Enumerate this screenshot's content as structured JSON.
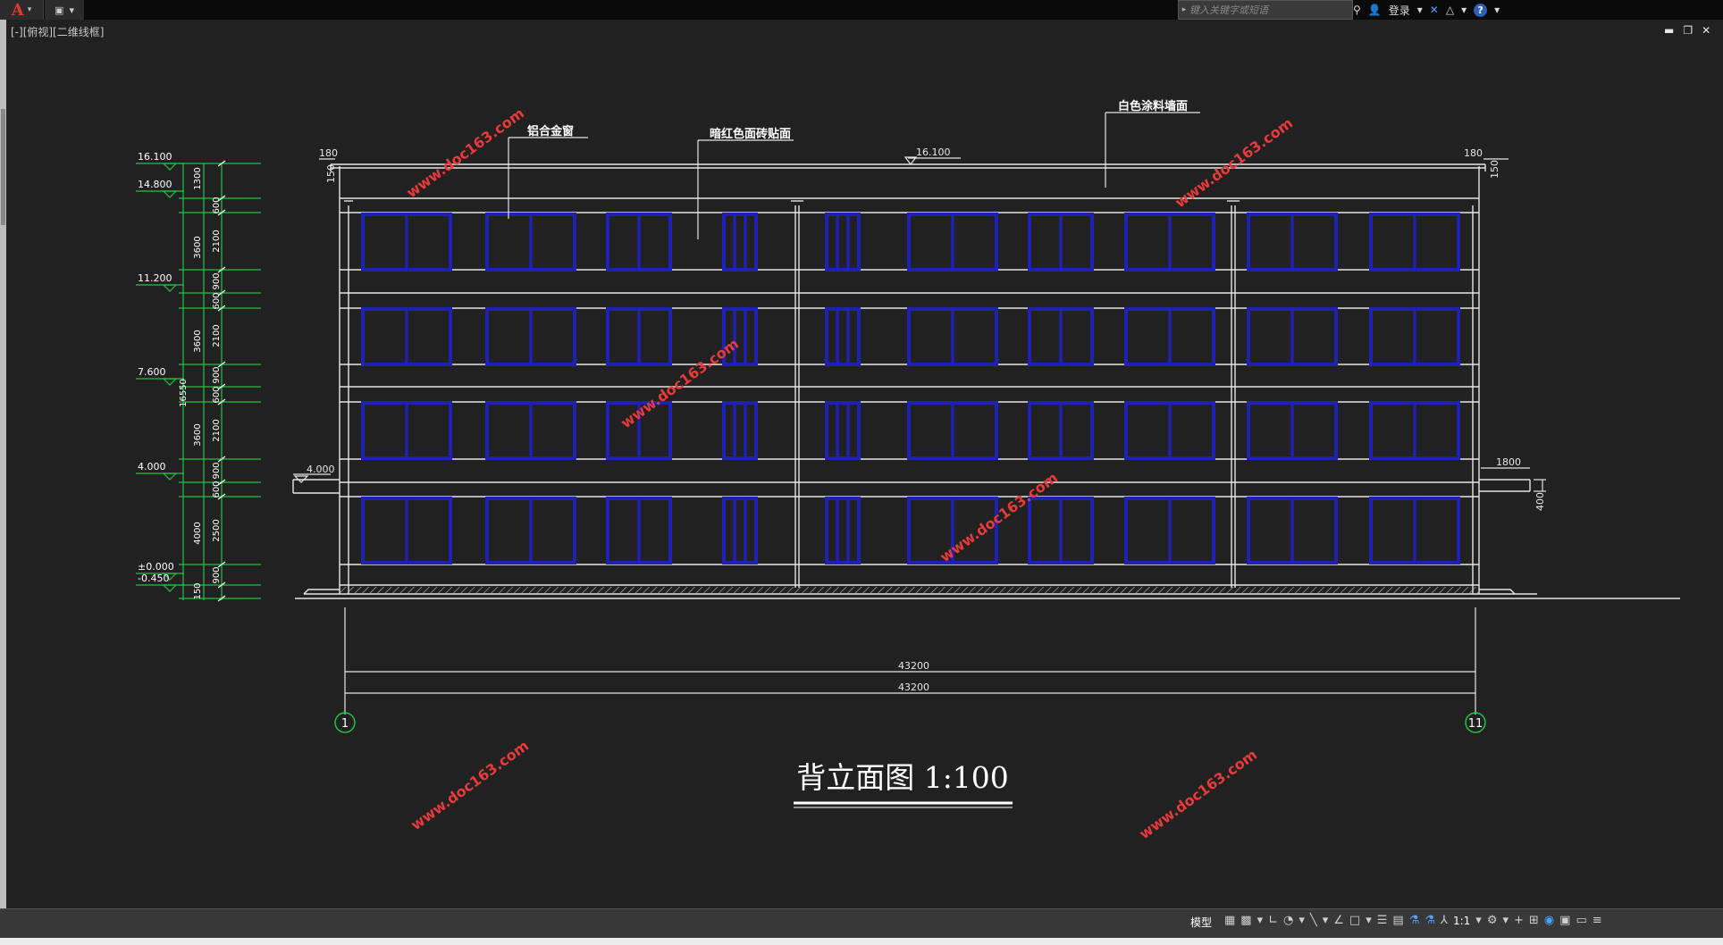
{
  "titlebar": {
    "search_placeholder": "键入关键字或短语",
    "login": "登录",
    "help_icon": "?"
  },
  "viewport": {
    "label": "[-][俯视][二维线框]"
  },
  "drawing": {
    "title": "背立面图 1:100",
    "annotations": {
      "window_material": "铝合金窗",
      "tile_facing": "暗红色面砖贴面",
      "white_paint": "白色涂料墙面"
    },
    "left_elevations": [
      "16.100",
      "14.800",
      "11.200",
      "7.600",
      "4.000",
      "±0.000",
      "-0.450"
    ],
    "left_segments_outer": [
      "1300",
      "3600",
      "16550",
      "3600",
      "3600",
      "4000",
      "150"
    ],
    "left_segments_inner": [
      "600",
      "2100",
      "900",
      "600",
      "2100",
      "900",
      "600",
      "2100",
      "900",
      "600",
      "2500",
      "900"
    ],
    "top_dims": {
      "left_offset": "180",
      "center_level": "16.100",
      "right_offset": "180",
      "parapet_left": "150",
      "parapet_right": "150"
    },
    "canopy_level": "4.000",
    "right_dims": {
      "width": "1800",
      "height": "400"
    },
    "overall_dims": [
      "43200",
      "43200"
    ],
    "axis_labels": [
      "1",
      "11"
    ],
    "watermark": "www.doc163.com"
  },
  "statusbar": {
    "model": "模型",
    "scale": "1:1"
  },
  "colors": {
    "background": "#212121",
    "elevation_green": "#21c442",
    "window_blue": "#1f21b3",
    "lines": "#e6e6e6",
    "watermark_red": "#e03030"
  }
}
